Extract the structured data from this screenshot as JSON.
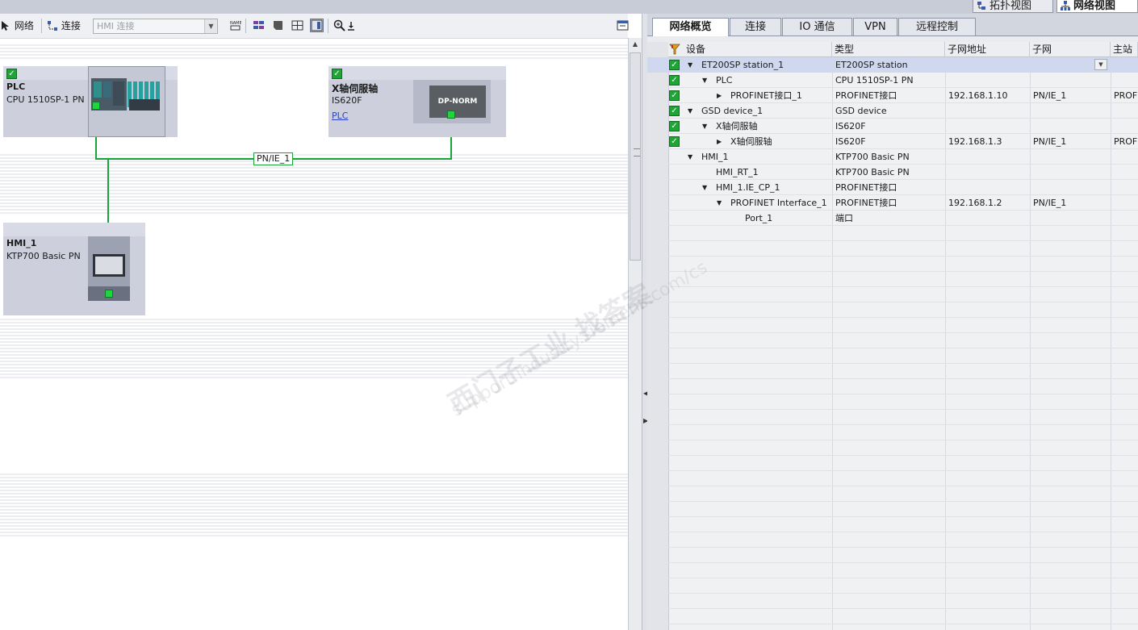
{
  "view_tabs": {
    "topology": "拓扑视图",
    "network": "网络视图"
  },
  "toolbar": {
    "network_label": "网络",
    "connection_label": "连接",
    "hmi_connection_placeholder": "HMI 连接"
  },
  "devices": {
    "plc": {
      "name": "PLC",
      "type": "CPU 1510SP-1 PN"
    },
    "servo": {
      "name": "X轴伺服轴",
      "type": "IS620F",
      "link": "PLC",
      "module_label": "DP-NORM"
    },
    "hmi": {
      "name": "HMI_1",
      "type": "KTP700 Basic PN"
    }
  },
  "subnet_label": "PN/IE_1",
  "right_tabs": [
    "网络概览",
    "连接",
    "IO 通信",
    "VPN",
    "远程控制"
  ],
  "grid": {
    "headers": [
      "设备",
      "类型",
      "子网地址",
      "子网",
      "主站"
    ],
    "rows": [
      {
        "indent": 0,
        "expand": "down",
        "checked": true,
        "selected": true,
        "device": "ET200SP station_1",
        "type": "ET200SP station",
        "address": "",
        "subnet": "",
        "master": ""
      },
      {
        "indent": 1,
        "expand": "down",
        "checked": true,
        "selected": false,
        "device": "PLC",
        "type": "CPU 1510SP-1 PN",
        "address": "",
        "subnet": "",
        "master": ""
      },
      {
        "indent": 2,
        "expand": "right",
        "checked": true,
        "selected": false,
        "device": "PROFINET接口_1",
        "type": "PROFINET接口",
        "address": "192.168.1.10",
        "subnet": "PN/IE_1",
        "master": "PROFI"
      },
      {
        "indent": 0,
        "expand": "down",
        "checked": true,
        "selected": false,
        "device": "GSD device_1",
        "type": "GSD device",
        "address": "",
        "subnet": "",
        "master": ""
      },
      {
        "indent": 1,
        "expand": "down",
        "checked": true,
        "selected": false,
        "device": "X轴伺服轴",
        "type": "IS620F",
        "address": "",
        "subnet": "",
        "master": ""
      },
      {
        "indent": 2,
        "expand": "right",
        "checked": true,
        "selected": false,
        "device": "X轴伺服轴",
        "type": "IS620F",
        "address": "192.168.1.3",
        "subnet": "PN/IE_1",
        "master": "PROFI"
      },
      {
        "indent": 0,
        "expand": "down",
        "checked": false,
        "selected": false,
        "device": "HMI_1",
        "type": "KTP700 Basic PN",
        "address": "",
        "subnet": "",
        "master": ""
      },
      {
        "indent": 1,
        "expand": "",
        "checked": false,
        "selected": false,
        "device": "HMI_RT_1",
        "type": "KTP700 Basic PN",
        "address": "",
        "subnet": "",
        "master": ""
      },
      {
        "indent": 1,
        "expand": "down",
        "checked": false,
        "selected": false,
        "device": "HMI_1.IE_CP_1",
        "type": "PROFINET接口",
        "address": "",
        "subnet": "",
        "master": ""
      },
      {
        "indent": 2,
        "expand": "down",
        "checked": false,
        "selected": false,
        "device": "PROFINET Interface_1",
        "type": "PROFINET接口",
        "address": "192.168.1.2",
        "subnet": "PN/IE_1",
        "master": ""
      },
      {
        "indent": 3,
        "expand": "",
        "checked": false,
        "selected": false,
        "device": "Port_1",
        "type": "端口",
        "address": "",
        "subnet": "",
        "master": ""
      }
    ]
  },
  "watermark": {
    "main": "西门子工业  找答案",
    "url": "support.industry.siemens.com/cs"
  },
  "colors": {
    "port_green": "#1ed43f",
    "link_green": "#16a536",
    "device_bg": "#cdd0dc",
    "selection": "#cfd8ee"
  }
}
